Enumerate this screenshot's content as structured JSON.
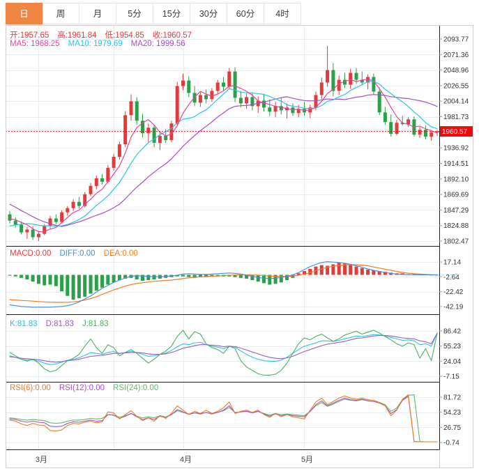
{
  "toolbar": {
    "tabs": [
      {
        "label": "日",
        "active": true
      },
      {
        "label": "周",
        "active": false
      },
      {
        "label": "月",
        "active": false
      },
      {
        "label": "5分",
        "active": false
      },
      {
        "label": "15分",
        "active": false
      },
      {
        "label": "30分",
        "active": false
      },
      {
        "label": "60分",
        "active": false
      },
      {
        "label": "4时",
        "active": false
      }
    ],
    "active_bg": "#ef8540"
  },
  "legends": {
    "ohlc": [
      {
        "text": "开:1957.65",
        "color": "#e23b3b"
      },
      {
        "text": "高:1961.84",
        "color": "#e23b3b"
      },
      {
        "text": "低:1954.85",
        "color": "#e23b3b"
      },
      {
        "text": "收:1960.57",
        "color": "#e23b3b"
      }
    ],
    "ma": [
      {
        "text": "MA5: 1968.25",
        "color": "#e8439c"
      },
      {
        "text": "MA10: 1979.69",
        "color": "#2cc3e4"
      },
      {
        "text": "MA20: 1999.56",
        "color": "#a64dc8"
      }
    ],
    "macd": [
      {
        "text": "MACD:0.00",
        "color": "#e23b3b"
      },
      {
        "text": "DIFF:0.00",
        "color": "#4a90d9"
      },
      {
        "text": "DEA:0.00",
        "color": "#ef7c24"
      }
    ],
    "kdj": [
      {
        "text": "K:81.83",
        "color": "#2cc3e4"
      },
      {
        "text": "D:81.83",
        "color": "#9a5bc0"
      },
      {
        "text": "J:81.83",
        "color": "#4db05e"
      }
    ],
    "rsi": [
      {
        "text": "RSI(6):0.00",
        "color": "#ef7c24"
      },
      {
        "text": "RSI(12):0.00",
        "color": "#ab4fc3"
      },
      {
        "text": "RSI(24):0.00",
        "color": "#5cb86a"
      }
    ]
  },
  "chart_data": {
    "type": "candlestick",
    "period": "日",
    "x_month_marks": [
      {
        "label": "3月",
        "index": 5
      },
      {
        "label": "4月",
        "index": 30
      },
      {
        "label": "5月",
        "index": 51
      }
    ],
    "vgrid_indices": [
      5,
      18,
      30,
      51
    ],
    "main": {
      "ohlc": {
        "open": 1957.65,
        "high": 1961.84,
        "low": 1954.85,
        "close": 1960.57
      },
      "ma_values": {
        "ma5": 1968.25,
        "ma10": 1979.69,
        "ma20": 1999.56
      },
      "current_price": "1960.57",
      "axis_labels": [
        "2093.77",
        "2071.36",
        "2048.96",
        "2026.55",
        "2004.14",
        "1981.73",
        "1936.92",
        "1914.51",
        "1892.10",
        "1869.69",
        "1847.29",
        "1824.88",
        "1802.47"
      ],
      "ylim": [
        1802.47,
        2093.77
      ],
      "prehistory_closes": [
        1920,
        1915,
        1910,
        1905,
        1900,
        1895,
        1890,
        1885,
        1880,
        1875,
        1815,
        1810,
        1805,
        1810,
        1815,
        1830,
        1832,
        1834,
        1836,
        1838
      ],
      "candles": [
        [
          1841,
          1846,
          1828,
          1832
        ],
        [
          1832,
          1837,
          1822,
          1826
        ],
        [
          1826,
          1831,
          1812,
          1815
        ],
        [
          1815,
          1823,
          1806,
          1819
        ],
        [
          1819,
          1824,
          1804,
          1808
        ],
        [
          1808,
          1817,
          1802.5,
          1813
        ],
        [
          1813,
          1827,
          1811,
          1824
        ],
        [
          1824,
          1839,
          1821,
          1835
        ],
        [
          1835,
          1841,
          1827,
          1830
        ],
        [
          1830,
          1847,
          1828,
          1844
        ],
        [
          1844,
          1853,
          1839,
          1850
        ],
        [
          1850,
          1863,
          1846,
          1859
        ],
        [
          1859,
          1866,
          1849,
          1853
        ],
        [
          1853,
          1873,
          1851,
          1870
        ],
        [
          1870,
          1886,
          1867,
          1882
        ],
        [
          1882,
          1897,
          1877,
          1893
        ],
        [
          1893,
          1899,
          1884,
          1888
        ],
        [
          1888,
          1912,
          1886,
          1908
        ],
        [
          1908,
          1928,
          1904,
          1924
        ],
        [
          1924,
          1946,
          1920,
          1942
        ],
        [
          1942,
          1990,
          1938,
          1984
        ],
        [
          1984,
          2014,
          1976,
          2004
        ],
        [
          2004,
          2010,
          1970,
          1976
        ],
        [
          1976,
          1986,
          1952,
          1958
        ],
        [
          1958,
          1972,
          1945,
          1966
        ],
        [
          1966,
          1970,
          1938,
          1944
        ],
        [
          1944,
          1960,
          1934,
          1954
        ],
        [
          1954,
          1964,
          1944,
          1948
        ],
        [
          1948,
          1976,
          1945,
          1972
        ],
        [
          1972,
          2032,
          1968,
          2026
        ],
        [
          2026,
          2044,
          2020,
          2034
        ],
        [
          2034,
          2040,
          2010,
          2016
        ],
        [
          2016,
          2026,
          1997,
          2002
        ],
        [
          2002,
          2017,
          1996,
          2013
        ],
        [
          2013,
          2021,
          2001,
          2007
        ],
        [
          2007,
          2023,
          2003,
          2019
        ],
        [
          2019,
          2035,
          2015,
          2031
        ],
        [
          2031,
          2039,
          2019,
          2025
        ],
        [
          2025,
          2052,
          2021,
          2047
        ],
        [
          2047,
          2053,
          2003,
          2009
        ],
        [
          2009,
          2019,
          1995,
          2001
        ],
        [
          2001,
          2015,
          1993,
          2010
        ],
        [
          2010,
          2017,
          1991,
          1997
        ],
        [
          1997,
          2011,
          1987,
          2005
        ],
        [
          2005,
          2013,
          1989,
          1995
        ],
        [
          1995,
          2007,
          1983,
          1989
        ],
        [
          1989,
          2003,
          1981,
          1997
        ],
        [
          1997,
          2009,
          1985,
          1991
        ],
        [
          1991,
          2001,
          1979,
          1995
        ],
        [
          1995,
          2001,
          1983,
          1987
        ],
        [
          1987,
          1999,
          1981,
          1993
        ],
        [
          1993,
          2003,
          1983,
          1988
        ],
        [
          1988,
          1999,
          1980,
          1995
        ],
        [
          1995,
          2018,
          1991,
          2013
        ],
        [
          2013,
          2038,
          2007,
          2031
        ],
        [
          2031,
          2084,
          2025,
          2049
        ],
        [
          2049,
          2059,
          2011,
          2019
        ],
        [
          2019,
          2041,
          2013,
          2035
        ],
        [
          2035,
          2045,
          2023,
          2028
        ],
        [
          2028,
          2051,
          2022,
          2045
        ],
        [
          2045,
          2052,
          2029,
          2035
        ],
        [
          2035,
          2047,
          2027,
          2031
        ],
        [
          2031,
          2043,
          2021,
          2039
        ],
        [
          2039,
          2044,
          2013,
          2018
        ],
        [
          2018,
          2024,
          1984,
          1988
        ],
        [
          1988,
          1996,
          1970,
          1974
        ],
        [
          1974,
          1985,
          1953,
          1957
        ],
        [
          1957,
          1977,
          1955,
          1973
        ],
        [
          1973,
          1983,
          1969,
          1971
        ],
        [
          1971,
          1981,
          1967,
          1978
        ],
        [
          1978,
          1982,
          1953,
          1956
        ],
        [
          1956,
          1967,
          1951,
          1963
        ],
        [
          1963,
          1969,
          1949,
          1953
        ],
        [
          1953,
          1963,
          1947,
          1959
        ],
        [
          1959,
          1963,
          1954,
          1960.57
        ]
      ]
    },
    "macd": {
      "values": {
        "macd": "0.00",
        "diff": "0.00",
        "dea": "0.00"
      },
      "axis_labels": [
        "17.14",
        "-2.64",
        "-22.42",
        "-42.19"
      ],
      "ylim": [
        -42.19,
        17.14
      ],
      "histogram": [
        -1,
        -2,
        -4,
        -6,
        -9,
        -12,
        -14,
        -13,
        -15,
        -22,
        -28,
        -33,
        -31,
        -29,
        -25,
        -21,
        -17,
        -13,
        -10,
        -7,
        -5,
        -4,
        -6,
        -8,
        -7,
        -6,
        -5,
        -4,
        -3,
        -2,
        -2,
        -3,
        -4,
        -3,
        -3,
        -2,
        -2,
        -2,
        -2,
        -3,
        -4,
        -5,
        -7,
        -9,
        -11,
        -13,
        -12,
        -10,
        -7,
        -4,
        2,
        5,
        8,
        11,
        13,
        12,
        14,
        16,
        15,
        13,
        11,
        9,
        7,
        6,
        5,
        4,
        3,
        2,
        2,
        1,
        1,
        0.5,
        0.5,
        0.3,
        0.2
      ],
      "diff": [
        -40,
        -41,
        -42,
        -42.5,
        -43,
        -43,
        -43,
        -43,
        -42.5,
        -42,
        -41,
        -39,
        -36,
        -32,
        -28,
        -23,
        -18,
        -14,
        -10,
        -7,
        -4,
        -2,
        -1,
        -1.5,
        -2,
        -2.5,
        -2.5,
        -2,
        -1.5,
        -0.5,
        1,
        1.5,
        1,
        0.5,
        0.5,
        1,
        1.5,
        2,
        2.5,
        2,
        1,
        -0.5,
        -2,
        -3.5,
        -4.5,
        -5,
        -4.5,
        -3.5,
        -2,
        0,
        3,
        7,
        11,
        14,
        16.5,
        17.5,
        17,
        16.5,
        15.5,
        14,
        12,
        10,
        8,
        6,
        4.5,
        3,
        2,
        1,
        0.5,
        0.3,
        0.2,
        0.1,
        0.1,
        0,
        0
      ],
      "dea": [
        -33,
        -33.5,
        -34,
        -34.5,
        -35,
        -35.5,
        -36,
        -36.3,
        -36.5,
        -36.5,
        -36.4,
        -36,
        -35,
        -33.5,
        -31.5,
        -29,
        -26,
        -23,
        -20,
        -17.5,
        -15,
        -13,
        -11.5,
        -10.5,
        -9.5,
        -8.5,
        -8,
        -7.5,
        -7,
        -6,
        -5,
        -4,
        -3.2,
        -2.6,
        -2.2,
        -1.8,
        -1.4,
        -1,
        -0.5,
        -0.2,
        0,
        0,
        -0.2,
        -0.5,
        -1,
        -1.5,
        -2,
        -2.2,
        -2,
        -1.5,
        -0.5,
        1,
        3,
        5.5,
        8,
        10,
        11.5,
        12.5,
        13.2,
        13.5,
        13.4,
        13,
        12,
        10.5,
        9,
        7.5,
        6,
        4.5,
        3.2,
        2.2,
        1.5,
        1,
        0.6,
        0.3,
        0.1
      ]
    },
    "kdj": {
      "values": {
        "k": "81.83",
        "d": "81.83",
        "j": "81.83"
      },
      "axis_labels": [
        "86.42",
        "55.23",
        "24.04",
        "-7.15"
      ],
      "ylim": [
        -7.15,
        86.42
      ],
      "k": [
        35,
        32,
        28,
        26,
        27,
        24,
        20,
        17,
        18,
        22,
        26,
        28,
        31,
        36,
        42,
        40,
        38,
        42,
        44,
        40,
        42,
        44,
        42,
        38,
        34,
        35,
        38,
        41,
        46,
        54,
        60,
        58,
        62,
        63,
        58,
        55,
        53,
        50,
        54,
        53,
        45,
        38,
        32,
        28,
        25,
        24,
        24,
        26,
        32,
        40,
        48,
        55,
        58,
        62,
        66,
        66,
        65,
        67,
        70,
        73,
        76,
        75,
        77,
        79,
        78,
        76,
        73,
        70,
        67,
        68,
        66,
        58,
        60,
        55,
        82
      ],
      "d": [
        33,
        32,
        30,
        29,
        28,
        27,
        25,
        23,
        22,
        23,
        25,
        26,
        28,
        31,
        34,
        35,
        36,
        38,
        40,
        40,
        41,
        42,
        42,
        41,
        39,
        38,
        38,
        39,
        42,
        46,
        51,
        53,
        56,
        58,
        58,
        57,
        56,
        54,
        55,
        54,
        51,
        47,
        43,
        39,
        35,
        32,
        30,
        29,
        31,
        34,
        39,
        44,
        48,
        52,
        56,
        59,
        61,
        63,
        65,
        68,
        71,
        72,
        74,
        76,
        77,
        77,
        76,
        74,
        72,
        71,
        70,
        66,
        64,
        60,
        82
      ],
      "j": [
        42,
        35,
        28,
        24,
        28,
        20,
        8,
        2,
        5,
        15,
        25,
        30,
        38,
        55,
        70,
        52,
        40,
        58,
        52,
        35,
        42,
        48,
        40,
        30,
        20,
        28,
        38,
        45,
        55,
        75,
        88,
        70,
        85,
        80,
        60,
        52,
        48,
        40,
        55,
        50,
        25,
        12,
        5,
        -2,
        -5,
        -5,
        -3,
        5,
        20,
        40,
        60,
        72,
        68,
        75,
        80,
        72,
        65,
        70,
        78,
        82,
        86,
        80,
        84,
        88,
        82,
        75,
        68,
        60,
        55,
        62,
        58,
        30,
        50,
        25,
        82
      ]
    },
    "rsi": {
      "values": {
        "rsi6": "0.00",
        "rsi12": "0.00",
        "rsi24": "0.00"
      },
      "axis_labels": [
        "81.72",
        "54.23",
        "26.75",
        "-0.74"
      ],
      "ylim": [
        -0.74,
        81.72
      ],
      "rsi6": [
        40,
        38,
        33,
        30,
        34,
        31,
        30,
        21,
        20,
        22,
        30,
        34,
        33,
        36,
        38,
        35,
        37,
        55,
        53,
        42,
        50,
        57,
        47,
        39,
        44,
        38,
        48,
        43,
        52,
        66,
        58,
        50,
        56,
        52,
        58,
        52,
        56,
        62,
        73,
        52,
        56,
        58,
        54,
        58,
        50,
        45,
        52,
        46,
        50,
        46,
        44,
        42,
        58,
        73,
        80,
        68,
        74,
        80,
        84,
        80,
        78,
        80,
        77,
        76,
        72,
        66,
        48,
        58,
        78,
        86,
        1,
        0.5,
        0.5,
        0.5,
        0.5
      ],
      "rsi12": [
        42,
        41,
        38,
        36,
        38,
        36,
        35,
        29,
        28,
        29,
        34,
        37,
        36,
        38,
        40,
        38,
        39,
        50,
        49,
        43,
        47,
        52,
        46,
        41,
        44,
        41,
        47,
        44,
        50,
        59,
        55,
        50,
        53,
        51,
        54,
        51,
        54,
        58,
        66,
        53,
        55,
        56,
        53,
        56,
        51,
        47,
        51,
        48,
        50,
        48,
        47,
        46,
        56,
        68,
        75,
        66,
        71,
        76,
        80,
        77,
        76,
        78,
        75,
        74,
        71,
        66,
        52,
        59,
        76,
        83,
        1,
        0.5,
        0.5,
        0.5,
        0.5
      ],
      "rsi24": [
        44,
        43,
        41,
        40,
        41,
        40,
        39,
        35,
        34,
        35,
        38,
        40,
        40,
        41,
        43,
        42,
        43,
        50,
        49,
        45,
        48,
        52,
        47,
        44,
        46,
        44,
        48,
        46,
        50,
        57,
        54,
        51,
        53,
        52,
        54,
        52,
        54,
        57,
        63,
        54,
        55,
        56,
        54,
        56,
        52,
        49,
        52,
        50,
        51,
        50,
        49,
        48,
        56,
        66,
        72,
        65,
        69,
        74,
        78,
        76,
        75,
        77,
        75,
        74,
        72,
        68,
        56,
        62,
        77,
        85,
        86,
        1,
        0.5,
        0.5,
        0.5
      ]
    },
    "colors": {
      "up": "#e23b3b",
      "down": "#2aa048",
      "ma5": "#e8439c",
      "ma10": "#2cc3e4",
      "ma20": "#a64dc8",
      "diff": "#4a90d9",
      "dea": "#ef7c24",
      "k": "#2cc3e4",
      "d": "#9a5bc0",
      "j": "#4db05e",
      "rsi6": "#ef7c24",
      "rsi12": "#ab4fc3",
      "rsi24": "#5cb86a",
      "price_line": "#e01515",
      "badge_bg": "#ee0a0a",
      "badge_text": "#ffffff",
      "grid": "#e8edf3",
      "separator": "#1d1d1d",
      "frame": "#d0d0d0",
      "axis_text": "#333333",
      "tick": "#999999"
    }
  }
}
